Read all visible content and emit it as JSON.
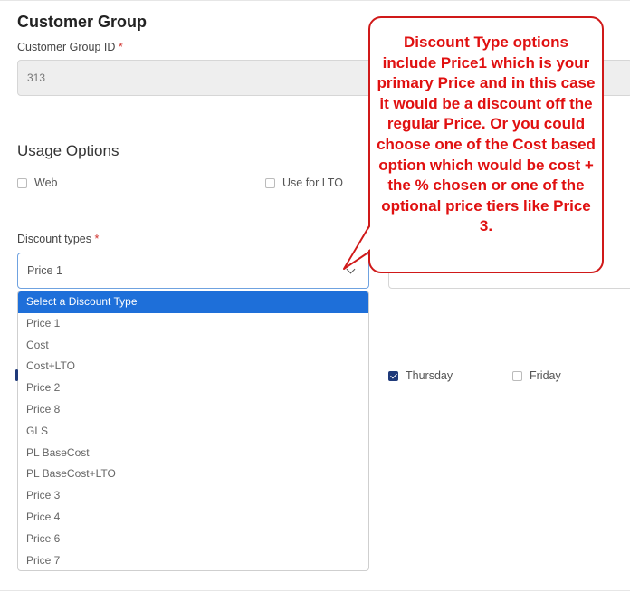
{
  "section": {
    "title": "Customer Group",
    "id_label": "Customer Group ID",
    "required_mark": "*",
    "id_value": "313"
  },
  "usage": {
    "title": "Usage Options",
    "web_label": "Web",
    "lto_label": "Use for LTO"
  },
  "discount": {
    "label": "Discount types",
    "selected_value": "Price 1",
    "options": [
      "Select a Discount Type",
      "Price 1",
      "Cost",
      "Cost+LTO",
      "Price 2",
      "Price 8",
      "GLS",
      "PL BaseCost",
      "PL BaseCost+LTO",
      "Price 3",
      "Price 4",
      "Price 6",
      "Price 7"
    ],
    "highlighted_index": 0
  },
  "days": {
    "thursday": {
      "label": "Thursday",
      "checked": true
    },
    "friday": {
      "label": "Friday",
      "checked": false
    }
  },
  "callout": {
    "text": "Discount Type options include Price1 which is your primary Price and in this case it would be a discount off the regular Price. Or you could choose one of the Cost based option which would be cost + the % chosen or one of the optional price tiers like Price 3."
  },
  "colors": {
    "accent": "#1e6fd9",
    "callout": "#e01010",
    "checked": "#1f3a7a"
  }
}
